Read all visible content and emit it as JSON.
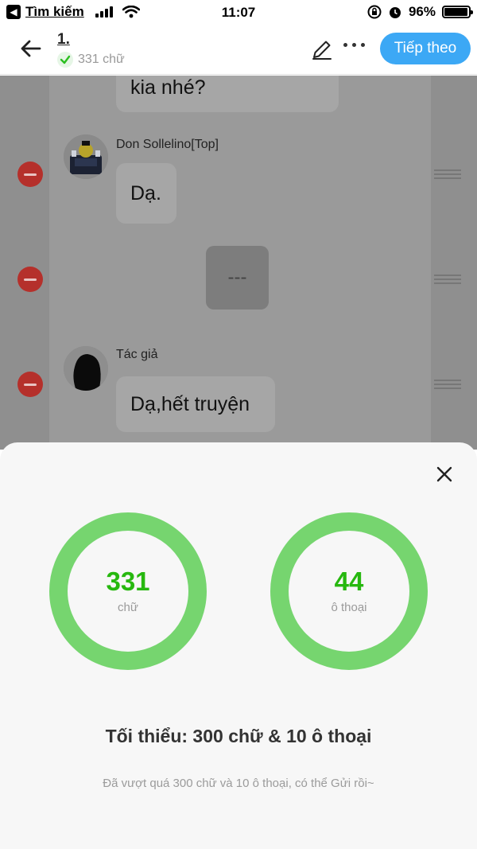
{
  "status_bar": {
    "back_label": "Tìm kiếm",
    "time": "11:07",
    "battery": "96%"
  },
  "nav": {
    "title": "1.",
    "word_count": "331 chữ",
    "next_label": "Tiếp theo"
  },
  "chat": {
    "messages": [
      {
        "text": "kia nhé?"
      },
      {
        "speaker": "Don Sollelino[Top]",
        "text": "Dạ."
      },
      {
        "text": "---"
      },
      {
        "speaker": "Tác giả",
        "text": "Dạ,hết truyện"
      }
    ]
  },
  "sheet": {
    "words": {
      "value": "331",
      "label": "chữ"
    },
    "dialogues": {
      "value": "44",
      "label": "ô thoại"
    },
    "minimum": "Tối thiểu: 300 chữ & 10 ô thoại",
    "hint": "Đã vượt quá 300 chữ và 10 ô thoại, có thể Gửi rồi~"
  },
  "colors": {
    "accent_blue": "#3ca8f5",
    "ring_green": "#76d56f",
    "number_green": "#27b80f",
    "remove_red": "#b5302b"
  },
  "icons": [
    "back-arrow-icon",
    "check-icon",
    "pencil-icon",
    "more-icon",
    "close-icon",
    "remove-icon",
    "drag-handle-icon"
  ]
}
